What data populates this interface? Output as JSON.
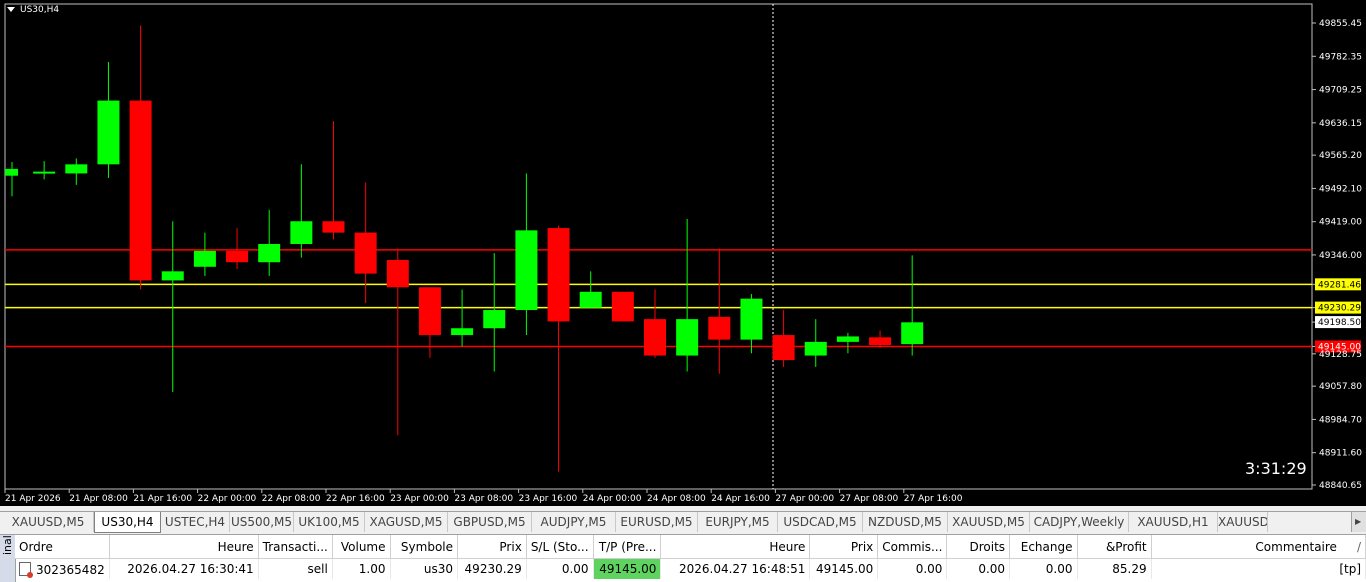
{
  "chart": {
    "symbol_title": "US30,H4",
    "countdown": "3:31:29",
    "colors": {
      "background": "#000000",
      "bull": "#00ff00",
      "bear": "#ff0000",
      "grid": "#ffffff",
      "text": "#ffffff"
    },
    "price_axis_labels": [
      "49855.45",
      "49782.35",
      "49709.25",
      "49636.15",
      "49565.20",
      "49492.10",
      "49419.00",
      "49346.00",
      "49281.46",
      "49230.29",
      "49198.50",
      "49145.00",
      "49128.75",
      "49057.80",
      "48984.70",
      "48911.60",
      "48840.65"
    ],
    "time_axis_labels": [
      "21 Apr 2026",
      "21 Apr 08:00",
      "21 Apr 16:00",
      "22 Apr 00:00",
      "22 Apr 08:00",
      "22 Apr 16:00",
      "23 Apr 00:00",
      "23 Apr 08:00",
      "23 Apr 16:00",
      "24 Apr 00:00",
      "24 Apr 08:00",
      "24 Apr 16:00",
      "27 Apr 00:00",
      "27 Apr 08:00",
      "27 Apr 16:00"
    ],
    "levels": [
      {
        "price": 49357.15,
        "label": "49357.15",
        "color": "#ff0000",
        "style": "solid"
      },
      {
        "price": 49281.46,
        "label": "49281.46",
        "color": "#ffff00",
        "style": "solid"
      },
      {
        "price": 49230.29,
        "label": "49230.29",
        "color": "#ffff00",
        "style": "solid"
      },
      {
        "price": 49145.0,
        "label": "49145.00",
        "color": "#ff0000",
        "style": "solid"
      },
      {
        "price": 49198.5,
        "label": "49198.50",
        "color": "#ffffff",
        "style": "tag-only"
      }
    ]
  },
  "chart_data": {
    "type": "candlestick",
    "ylim": [
      48840.65,
      49855.45
    ],
    "grid": false,
    "candles": [
      {
        "o": 49520,
        "h": 49550,
        "l": 49475,
        "c": 49535
      },
      {
        "o": 49527,
        "h": 49552,
        "l": 49512,
        "c": 49529
      },
      {
        "o": 49525,
        "h": 49558,
        "l": 49500,
        "c": 49545
      },
      {
        "o": 49545,
        "h": 49770,
        "l": 49515,
        "c": 49685
      },
      {
        "o": 49685,
        "h": 49850,
        "l": 49270,
        "c": 49290
      },
      {
        "o": 49290,
        "h": 49420,
        "l": 49045,
        "c": 49310
      },
      {
        "o": 49320,
        "h": 49395,
        "l": 49300,
        "c": 49355
      },
      {
        "o": 49355,
        "h": 49405,
        "l": 49315,
        "c": 49330
      },
      {
        "o": 49330,
        "h": 49445,
        "l": 49300,
        "c": 49370
      },
      {
        "o": 49370,
        "h": 49545,
        "l": 49340,
        "c": 49420
      },
      {
        "o": 49420,
        "h": 49640,
        "l": 49380,
        "c": 49395
      },
      {
        "o": 49395,
        "h": 49505,
        "l": 49240,
        "c": 49305
      },
      {
        "o": 49335,
        "h": 49360,
        "l": 48950,
        "c": 49275
      },
      {
        "o": 49275,
        "h": 49275,
        "l": 49120,
        "c": 49170
      },
      {
        "o": 49170,
        "h": 49270,
        "l": 49145,
        "c": 49185
      },
      {
        "o": 49185,
        "h": 49350,
        "l": 49090,
        "c": 49225
      },
      {
        "o": 49225,
        "h": 49525,
        "l": 49170,
        "c": 49400
      },
      {
        "o": 49405,
        "h": 49410,
        "l": 48870,
        "c": 49200
      },
      {
        "o": 49230,
        "h": 49310,
        "l": 49230,
        "c": 49265
      },
      {
        "o": 49265,
        "h": 49265,
        "l": 49205,
        "c": 49200
      },
      {
        "o": 49205,
        "h": 49270,
        "l": 49120,
        "c": 49125
      },
      {
        "o": 49125,
        "h": 49425,
        "l": 49090,
        "c": 49205
      },
      {
        "o": 49210,
        "h": 49360,
        "l": 49085,
        "c": 49160
      },
      {
        "o": 49160,
        "h": 49260,
        "l": 49130,
        "c": 49250
      },
      {
        "o": 49170,
        "h": 49225,
        "l": 49100,
        "c": 49115
      },
      {
        "o": 49125,
        "h": 49205,
        "l": 49100,
        "c": 49155
      },
      {
        "o": 49155,
        "h": 49175,
        "l": 49130,
        "c": 49167
      },
      {
        "o": 49165,
        "h": 49180,
        "l": 49142,
        "c": 49148
      },
      {
        "o": 49150,
        "h": 49345,
        "l": 49125,
        "c": 49198
      }
    ]
  },
  "tabs": [
    {
      "label": "XAUUSD,M5",
      "active": false
    },
    {
      "label": "US30,H4",
      "active": true
    },
    {
      "label": "USTEC,H4",
      "active": false
    },
    {
      "label": "US500,M5",
      "active": false
    },
    {
      "label": "UK100,M5",
      "active": false
    },
    {
      "label": "XAGUSD,M5",
      "active": false
    },
    {
      "label": "GBPUSD,M5",
      "active": false
    },
    {
      "label": "AUDJPY,M5",
      "active": false
    },
    {
      "label": "EURUSD,M5",
      "active": false
    },
    {
      "label": "EURJPY,M5",
      "active": false
    },
    {
      "label": "USDCAD,M5",
      "active": false
    },
    {
      "label": "NZDUSD,M5",
      "active": false
    },
    {
      "label": "XAUUSD,M5",
      "active": false
    },
    {
      "label": "CADJPY,Weekly",
      "active": false
    },
    {
      "label": "XAUUSD,H1",
      "active": false
    },
    {
      "label": "XAUUSD,M",
      "active": false
    }
  ],
  "terminal": {
    "side_label": "inal",
    "headers": [
      "Ordre",
      "Heure",
      "Transacti...",
      "Volume",
      "Symbole",
      "Prix",
      "S/L (Sto...",
      "T/P (Pre...",
      "Heure",
      "Prix",
      "Commis...",
      "Droits",
      "Echange",
      "&Profit",
      "Commentaire"
    ],
    "sort_indicator": "/",
    "rows": [
      {
        "cells": [
          "302365482",
          "2026.04.27 16:30:41",
          "sell",
          "1.00",
          "us30",
          "49230.29",
          "0.00",
          "49145.00",
          "2026.04.27 16:48:51",
          "49145.00",
          "0.00",
          "0.00",
          "0.00",
          "85.29",
          "[tp]"
        ]
      }
    ]
  }
}
